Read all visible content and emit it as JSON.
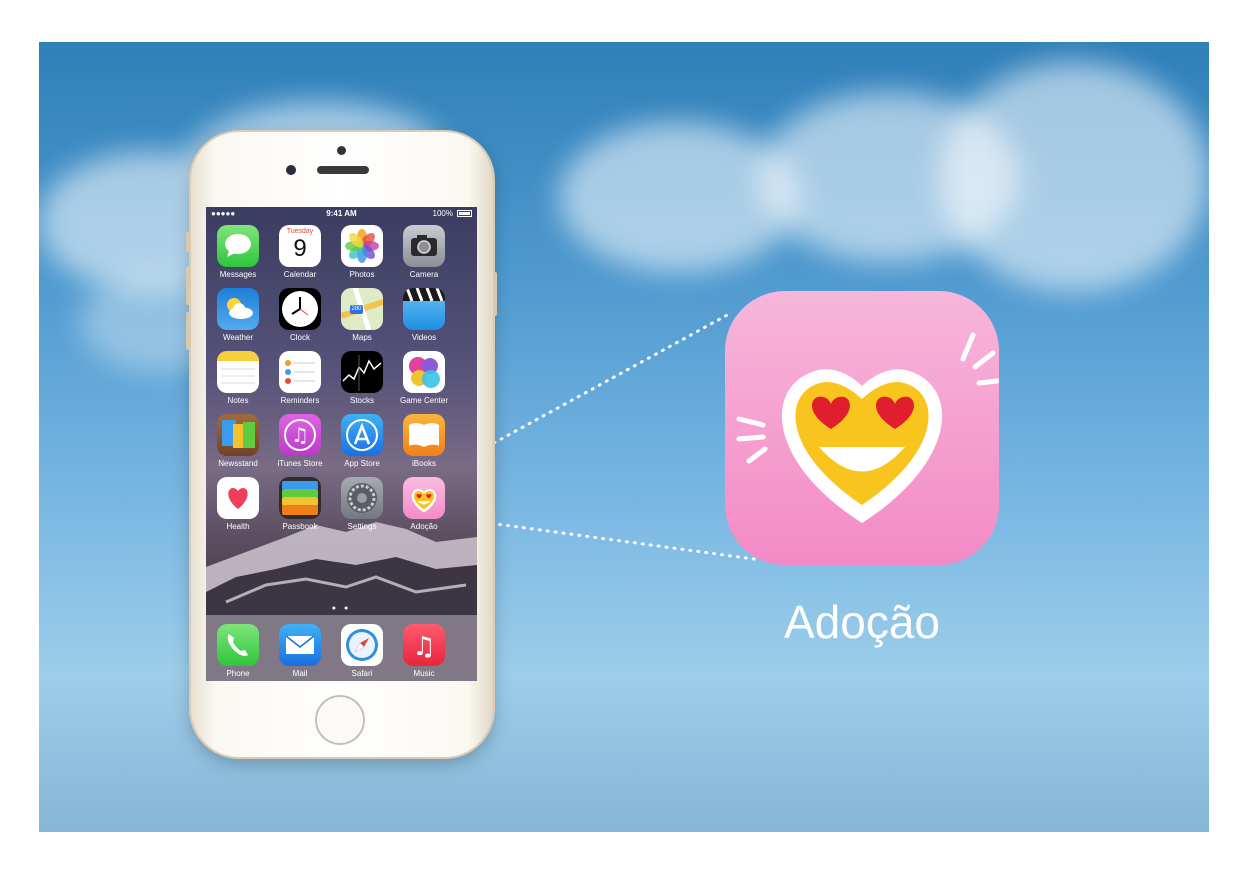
{
  "status_bar": {
    "signal": "●●●●● ",
    "time": "9:41 AM",
    "battery": "100%"
  },
  "home_screen": {
    "apps": [
      {
        "label": "Messages",
        "icon": "messages-icon",
        "color": "#4cd964"
      },
      {
        "label": "Calendar",
        "icon": "calendar-icon",
        "color": "#ffffff",
        "calendar_day": "Tuesday",
        "calendar_date": "9"
      },
      {
        "label": "Photos",
        "icon": "photos-icon",
        "color": "#ffffff"
      },
      {
        "label": "Camera",
        "icon": "camera-icon",
        "color": "#8e8e93"
      },
      {
        "label": "Weather",
        "icon": "weather-icon",
        "color": "#2f8ee0"
      },
      {
        "label": "Clock",
        "icon": "clock-icon",
        "color": "#000000"
      },
      {
        "label": "Maps",
        "icon": "maps-icon",
        "color": "#e7f0d3",
        "road_sign": "280"
      },
      {
        "label": "Videos",
        "icon": "videos-icon",
        "color": "#3aa0e8"
      },
      {
        "label": "Notes",
        "icon": "notes-icon",
        "color": "#ffffff"
      },
      {
        "label": "Reminders",
        "icon": "reminders-icon",
        "color": "#ffffff"
      },
      {
        "label": "Stocks",
        "icon": "stocks-icon",
        "color": "#000000"
      },
      {
        "label": "Game Center",
        "icon": "game-center-icon",
        "color": "#ffffff"
      },
      {
        "label": "Newsstand",
        "icon": "newsstand-icon",
        "color": "#2f6fb0"
      },
      {
        "label": "iTunes Store",
        "icon": "itunes-store-icon",
        "color": "#d14fd6"
      },
      {
        "label": "App Store",
        "icon": "app-store-icon",
        "color": "#1a8ef5"
      },
      {
        "label": "iBooks",
        "icon": "ibooks-icon",
        "color": "#f39a1f"
      },
      {
        "label": "Health",
        "icon": "health-icon",
        "color": "#ffffff"
      },
      {
        "label": "Passbook",
        "icon": "passbook-icon",
        "color": "#3c3c3c"
      },
      {
        "label": "Settings",
        "icon": "settings-icon",
        "color": "#8e8e93"
      },
      {
        "label": "Adoção",
        "icon": "adocao-icon",
        "color": "#f7a8d6"
      }
    ],
    "page_dots": "● ●",
    "dock": [
      {
        "label": "Phone",
        "icon": "phone-icon",
        "color": "#4cd964"
      },
      {
        "label": "Mail",
        "icon": "mail-icon",
        "color": "#1f8fef"
      },
      {
        "label": "Safari",
        "icon": "safari-icon",
        "color": "#ffffff"
      },
      {
        "label": "Music",
        "icon": "music-icon",
        "color": "#f2364f"
      }
    ]
  },
  "featured_app": {
    "name": "Adoção",
    "icon": "heart-eyes-emoji-icon",
    "icon_color": "#f7a8d6"
  }
}
